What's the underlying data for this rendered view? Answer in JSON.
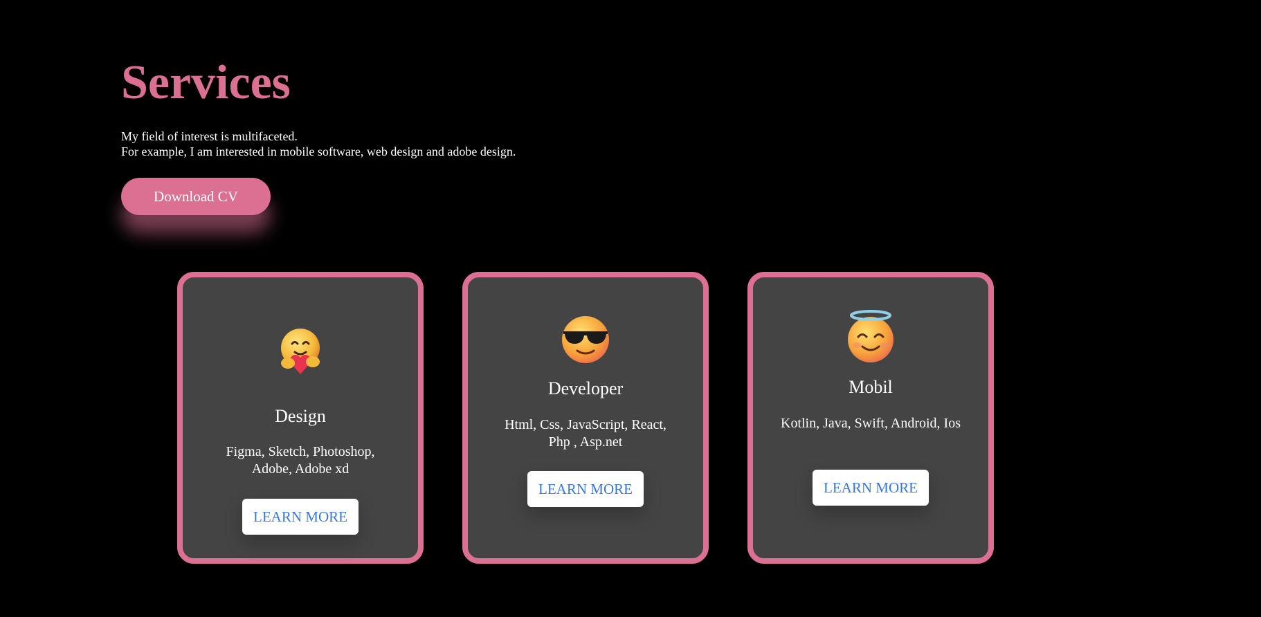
{
  "services": {
    "title": "Services",
    "intro_line1": "My field of interest is multifaceted.",
    "intro_line2": "For example, I am interested in mobile software, web design and adobe design.",
    "cv_button": "Download CV"
  },
  "cards": [
    {
      "title": "Design",
      "skills": "Figma, Sketch, Photoshop, Adobe, Adobe xd",
      "button": "LEARN MORE",
      "icon": "hugging-face-emoji-icon"
    },
    {
      "title": "Developer",
      "skills": "Html, Css, JavaScript, React, Php , Asp.net",
      "button": "LEARN MORE",
      "icon": "sunglasses-face-emoji-icon"
    },
    {
      "title": "Mobil",
      "skills": "Kotlin, Java, Swift, Android, Ios",
      "button": "LEARN MORE",
      "icon": "halo-face-emoji-icon"
    }
  ],
  "colors": {
    "background": "#000000",
    "accent": "#db7093",
    "card_background": "#444444",
    "link_text": "#3a78d8"
  }
}
